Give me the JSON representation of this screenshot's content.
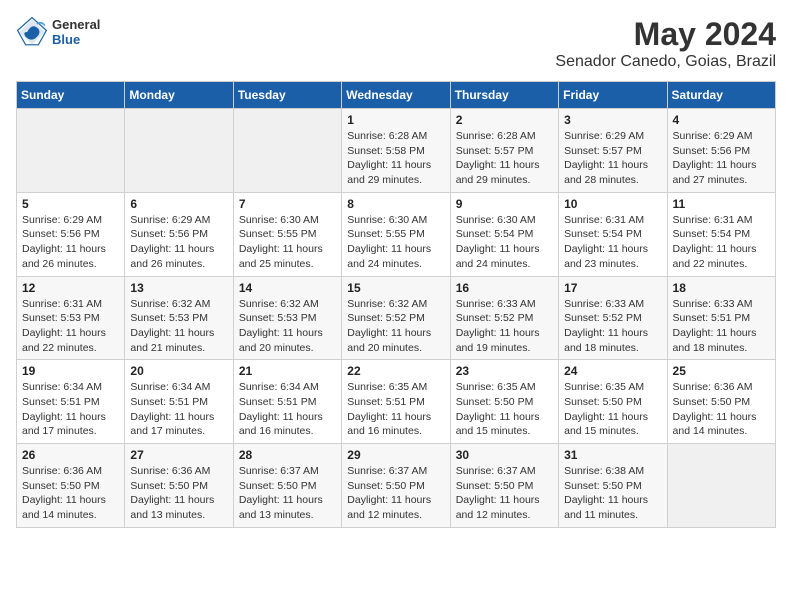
{
  "header": {
    "logo": {
      "general": "General",
      "blue": "Blue"
    },
    "title": "May 2024",
    "subtitle": "Senador Canedo, Goias, Brazil"
  },
  "days_of_week": [
    "Sunday",
    "Monday",
    "Tuesday",
    "Wednesday",
    "Thursday",
    "Friday",
    "Saturday"
  ],
  "weeks": [
    [
      {
        "day": "",
        "info": ""
      },
      {
        "day": "",
        "info": ""
      },
      {
        "day": "",
        "info": ""
      },
      {
        "day": "1",
        "info": "Sunrise: 6:28 AM\nSunset: 5:58 PM\nDaylight: 11 hours and 29 minutes."
      },
      {
        "day": "2",
        "info": "Sunrise: 6:28 AM\nSunset: 5:57 PM\nDaylight: 11 hours and 29 minutes."
      },
      {
        "day": "3",
        "info": "Sunrise: 6:29 AM\nSunset: 5:57 PM\nDaylight: 11 hours and 28 minutes."
      },
      {
        "day": "4",
        "info": "Sunrise: 6:29 AM\nSunset: 5:56 PM\nDaylight: 11 hours and 27 minutes."
      }
    ],
    [
      {
        "day": "5",
        "info": "Sunrise: 6:29 AM\nSunset: 5:56 PM\nDaylight: 11 hours and 26 minutes."
      },
      {
        "day": "6",
        "info": "Sunrise: 6:29 AM\nSunset: 5:56 PM\nDaylight: 11 hours and 26 minutes."
      },
      {
        "day": "7",
        "info": "Sunrise: 6:30 AM\nSunset: 5:55 PM\nDaylight: 11 hours and 25 minutes."
      },
      {
        "day": "8",
        "info": "Sunrise: 6:30 AM\nSunset: 5:55 PM\nDaylight: 11 hours and 24 minutes."
      },
      {
        "day": "9",
        "info": "Sunrise: 6:30 AM\nSunset: 5:54 PM\nDaylight: 11 hours and 24 minutes."
      },
      {
        "day": "10",
        "info": "Sunrise: 6:31 AM\nSunset: 5:54 PM\nDaylight: 11 hours and 23 minutes."
      },
      {
        "day": "11",
        "info": "Sunrise: 6:31 AM\nSunset: 5:54 PM\nDaylight: 11 hours and 22 minutes."
      }
    ],
    [
      {
        "day": "12",
        "info": "Sunrise: 6:31 AM\nSunset: 5:53 PM\nDaylight: 11 hours and 22 minutes."
      },
      {
        "day": "13",
        "info": "Sunrise: 6:32 AM\nSunset: 5:53 PM\nDaylight: 11 hours and 21 minutes."
      },
      {
        "day": "14",
        "info": "Sunrise: 6:32 AM\nSunset: 5:53 PM\nDaylight: 11 hours and 20 minutes."
      },
      {
        "day": "15",
        "info": "Sunrise: 6:32 AM\nSunset: 5:52 PM\nDaylight: 11 hours and 20 minutes."
      },
      {
        "day": "16",
        "info": "Sunrise: 6:33 AM\nSunset: 5:52 PM\nDaylight: 11 hours and 19 minutes."
      },
      {
        "day": "17",
        "info": "Sunrise: 6:33 AM\nSunset: 5:52 PM\nDaylight: 11 hours and 18 minutes."
      },
      {
        "day": "18",
        "info": "Sunrise: 6:33 AM\nSunset: 5:51 PM\nDaylight: 11 hours and 18 minutes."
      }
    ],
    [
      {
        "day": "19",
        "info": "Sunrise: 6:34 AM\nSunset: 5:51 PM\nDaylight: 11 hours and 17 minutes."
      },
      {
        "day": "20",
        "info": "Sunrise: 6:34 AM\nSunset: 5:51 PM\nDaylight: 11 hours and 17 minutes."
      },
      {
        "day": "21",
        "info": "Sunrise: 6:34 AM\nSunset: 5:51 PM\nDaylight: 11 hours and 16 minutes."
      },
      {
        "day": "22",
        "info": "Sunrise: 6:35 AM\nSunset: 5:51 PM\nDaylight: 11 hours and 16 minutes."
      },
      {
        "day": "23",
        "info": "Sunrise: 6:35 AM\nSunset: 5:50 PM\nDaylight: 11 hours and 15 minutes."
      },
      {
        "day": "24",
        "info": "Sunrise: 6:35 AM\nSunset: 5:50 PM\nDaylight: 11 hours and 15 minutes."
      },
      {
        "day": "25",
        "info": "Sunrise: 6:36 AM\nSunset: 5:50 PM\nDaylight: 11 hours and 14 minutes."
      }
    ],
    [
      {
        "day": "26",
        "info": "Sunrise: 6:36 AM\nSunset: 5:50 PM\nDaylight: 11 hours and 14 minutes."
      },
      {
        "day": "27",
        "info": "Sunrise: 6:36 AM\nSunset: 5:50 PM\nDaylight: 11 hours and 13 minutes."
      },
      {
        "day": "28",
        "info": "Sunrise: 6:37 AM\nSunset: 5:50 PM\nDaylight: 11 hours and 13 minutes."
      },
      {
        "day": "29",
        "info": "Sunrise: 6:37 AM\nSunset: 5:50 PM\nDaylight: 11 hours and 12 minutes."
      },
      {
        "day": "30",
        "info": "Sunrise: 6:37 AM\nSunset: 5:50 PM\nDaylight: 11 hours and 12 minutes."
      },
      {
        "day": "31",
        "info": "Sunrise: 6:38 AM\nSunset: 5:50 PM\nDaylight: 11 hours and 11 minutes."
      },
      {
        "day": "",
        "info": ""
      }
    ]
  ]
}
